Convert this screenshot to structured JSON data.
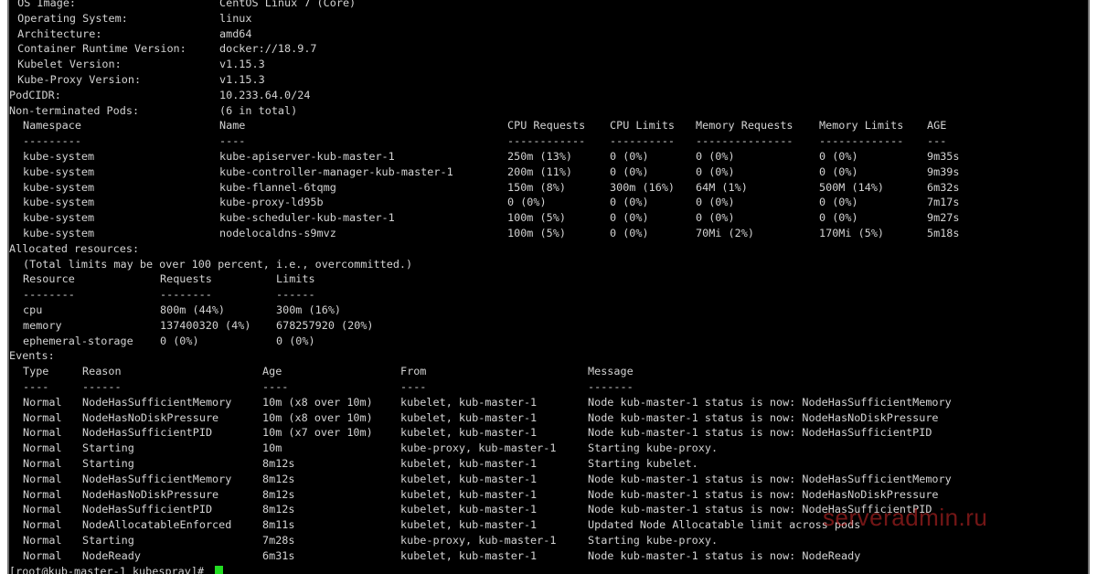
{
  "node_info": [
    {
      "label": " OS Image:",
      "value": "CentOS Linux 7 (Core)"
    },
    {
      "label": " Operating System:",
      "value": "linux"
    },
    {
      "label": " Architecture:",
      "value": "amd64"
    },
    {
      "label": " Container Runtime Version:",
      "value": "docker://18.9.7"
    },
    {
      "label": " Kubelet Version:",
      "value": "v1.15.3"
    },
    {
      "label": " Kube-Proxy Version:",
      "value": "v1.15.3"
    }
  ],
  "podcidr": {
    "label": "PodCIDR:",
    "value": "10.233.64.0/24"
  },
  "pods_header": {
    "label": "Non-terminated Pods:",
    "value": "(6 in total)"
  },
  "pods_table": {
    "columns": [
      "Namespace",
      "Name",
      "CPU Requests",
      "CPU Limits",
      "Memory Requests",
      "Memory Limits",
      "AGE"
    ],
    "separators": [
      "---------",
      "----",
      "------------",
      "----------",
      "---------------",
      "-------------",
      "---"
    ],
    "rows": [
      [
        "kube-system",
        "kube-apiserver-kub-master-1",
        "250m (13%)",
        "0 (0%)",
        "0 (0%)",
        "0 (0%)",
        "9m35s"
      ],
      [
        "kube-system",
        "kube-controller-manager-kub-master-1",
        "200m (11%)",
        "0 (0%)",
        "0 (0%)",
        "0 (0%)",
        "9m39s"
      ],
      [
        "kube-system",
        "kube-flannel-6tqmg",
        "150m (8%)",
        "300m (16%)",
        "64M (1%)",
        "500M (14%)",
        "6m32s"
      ],
      [
        "kube-system",
        "kube-proxy-ld95b",
        "0 (0%)",
        "0 (0%)",
        "0 (0%)",
        "0 (0%)",
        "7m17s"
      ],
      [
        "kube-system",
        "kube-scheduler-kub-master-1",
        "100m (5%)",
        "0 (0%)",
        "0 (0%)",
        "0 (0%)",
        "9m27s"
      ],
      [
        "kube-system",
        "nodelocaldns-s9mvz",
        "100m (5%)",
        "0 (0%)",
        "70Mi (2%)",
        "170Mi (5%)",
        "5m18s"
      ]
    ]
  },
  "allocated": {
    "label": "Allocated resources:",
    "note": "(Total limits may be over 100 percent, i.e., overcommitted.)",
    "columns": [
      "Resource",
      "Requests",
      "Limits"
    ],
    "separators": [
      "--------",
      "--------",
      "------"
    ],
    "rows": [
      [
        "cpu",
        "800m (44%)",
        "300m (16%)"
      ],
      [
        "memory",
        "137400320 (4%)",
        "678257920 (20%)"
      ],
      [
        "ephemeral-storage",
        "0 (0%)",
        "0 (0%)"
      ]
    ]
  },
  "events": {
    "label": "Events:",
    "columns": [
      "Type",
      "Reason",
      "Age",
      "From",
      "Message"
    ],
    "separators": [
      "----",
      "------",
      "----",
      "----",
      "-------"
    ],
    "rows": [
      [
        "Normal",
        "NodeHasSufficientMemory",
        "10m (x8 over 10m)",
        "kubelet, kub-master-1",
        "Node kub-master-1 status is now: NodeHasSufficientMemory"
      ],
      [
        "Normal",
        "NodeHasNoDiskPressure",
        "10m (x8 over 10m)",
        "kubelet, kub-master-1",
        "Node kub-master-1 status is now: NodeHasNoDiskPressure"
      ],
      [
        "Normal",
        "NodeHasSufficientPID",
        "10m (x7 over 10m)",
        "kubelet, kub-master-1",
        "Node kub-master-1 status is now: NodeHasSufficientPID"
      ],
      [
        "Normal",
        "Starting",
        "10m",
        "kube-proxy, kub-master-1",
        "Starting kube-proxy."
      ],
      [
        "Normal",
        "Starting",
        "8m12s",
        "kubelet, kub-master-1",
        "Starting kubelet."
      ],
      [
        "Normal",
        "NodeHasSufficientMemory",
        "8m12s",
        "kubelet, kub-master-1",
        "Node kub-master-1 status is now: NodeHasSufficientMemory"
      ],
      [
        "Normal",
        "NodeHasNoDiskPressure",
        "8m12s",
        "kubelet, kub-master-1",
        "Node kub-master-1 status is now: NodeHasNoDiskPressure"
      ],
      [
        "Normal",
        "NodeHasSufficientPID",
        "8m12s",
        "kubelet, kub-master-1",
        "Node kub-master-1 status is now: NodeHasSufficientPID"
      ],
      [
        "Normal",
        "NodeAllocatableEnforced",
        "8m11s",
        "kubelet, kub-master-1",
        "Updated Node Allocatable limit across pods"
      ],
      [
        "Normal",
        "Starting",
        "7m28s",
        "kube-proxy, kub-master-1",
        "Starting kube-proxy."
      ],
      [
        "Normal",
        "NodeReady",
        "6m31s",
        "kubelet, kub-master-1",
        "Node kub-master-1 status is now: NodeReady"
      ]
    ]
  },
  "prompt": "[root@kub-master-1 kubespray]# ",
  "watermark": "serveradmin.ru",
  "colors": {
    "background": "#000000",
    "text": "#d3d3d3",
    "cursor": "#22dd22",
    "watermark": "#d22828"
  }
}
